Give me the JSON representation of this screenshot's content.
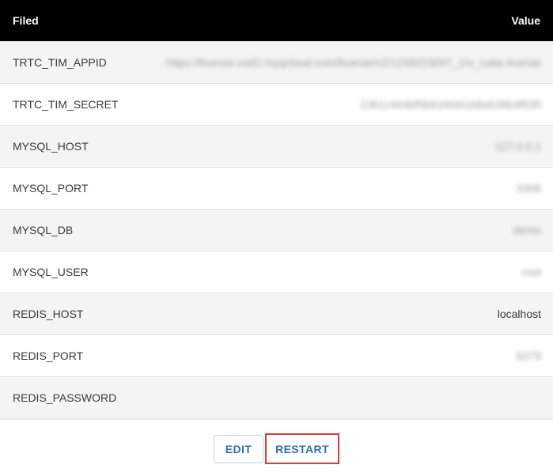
{
  "table": {
    "header": {
      "field": "Filed",
      "value": "Value"
    },
    "rows": [
      {
        "field": "TRTC_TIM_APPID",
        "value": "https://license.vod2.myqcloud.com/license/v2/1259223007_1/v_cube.license",
        "blurred": true
      },
      {
        "field": "TRTC_TIM_SECRET",
        "value": "1361c444bf5b61f4d41b8a526b4f635",
        "blurred": true
      },
      {
        "field": "MYSQL_HOST",
        "value": "127.0.0.1",
        "blurred": true
      },
      {
        "field": "MYSQL_PORT",
        "value": "3306",
        "blurred": true
      },
      {
        "field": "MYSQL_DB",
        "value": "demo",
        "blurred": true
      },
      {
        "field": "MYSQL_USER",
        "value": "root",
        "blurred": true
      },
      {
        "field": "REDIS_HOST",
        "value": "localhost",
        "blurred": false
      },
      {
        "field": "REDIS_PORT",
        "value": "6379",
        "blurred": true
      },
      {
        "field": "REDIS_PASSWORD",
        "value": "",
        "blurred": false
      }
    ]
  },
  "actions": {
    "edit_label": "EDIT",
    "restart_label": "RESTART"
  },
  "colors": {
    "header_bg": "#000000",
    "row_alt_bg": "#f4f4f4",
    "button_text": "#2f6fb7",
    "highlight_border": "#d93a3a"
  }
}
